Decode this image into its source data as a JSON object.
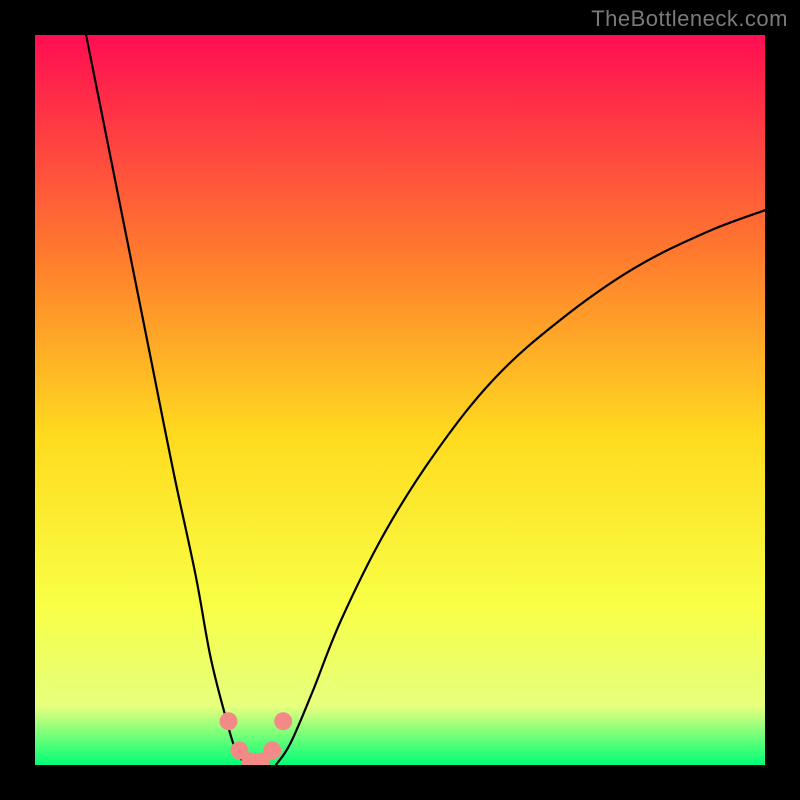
{
  "watermark": "TheBottleneck.com",
  "chart_data": {
    "type": "line",
    "title": "",
    "xlabel": "",
    "ylabel": "",
    "x_range": [
      0,
      100
    ],
    "y_range": [
      0,
      100
    ],
    "background": {
      "type": "vertical_gradient",
      "top_color": "#ff0d53",
      "upper_mid_color": "#ff7a2e",
      "mid_color": "#ffdb1f",
      "lower_mid_color": "#f8ff45",
      "lower_color": "#e6ff7e",
      "bottom_color": "#00ff76"
    },
    "curves": [
      {
        "name": "left_branch",
        "color": "#000000",
        "points": [
          {
            "x": 7,
            "y": 100
          },
          {
            "x": 10,
            "y": 85
          },
          {
            "x": 13,
            "y": 70
          },
          {
            "x": 16,
            "y": 55
          },
          {
            "x": 19,
            "y": 40
          },
          {
            "x": 22,
            "y": 26
          },
          {
            "x": 24,
            "y": 15
          },
          {
            "x": 26,
            "y": 7
          },
          {
            "x": 27.5,
            "y": 2
          },
          {
            "x": 29,
            "y": 0
          }
        ]
      },
      {
        "name": "right_branch",
        "color": "#000000",
        "points": [
          {
            "x": 33,
            "y": 0
          },
          {
            "x": 35,
            "y": 3
          },
          {
            "x": 38,
            "y": 10
          },
          {
            "x": 42,
            "y": 20
          },
          {
            "x": 48,
            "y": 32
          },
          {
            "x": 55,
            "y": 43
          },
          {
            "x": 63,
            "y": 53
          },
          {
            "x": 72,
            "y": 61
          },
          {
            "x": 82,
            "y": 68
          },
          {
            "x": 92,
            "y": 73
          },
          {
            "x": 100,
            "y": 76
          }
        ]
      }
    ],
    "highlight_points": {
      "color": "#f48a88",
      "points": [
        {
          "x": 26.5,
          "y": 6
        },
        {
          "x": 28,
          "y": 2
        },
        {
          "x": 29.5,
          "y": 0.5
        },
        {
          "x": 31,
          "y": 0.5
        },
        {
          "x": 32.5,
          "y": 2
        },
        {
          "x": 34,
          "y": 6
        }
      ]
    }
  }
}
